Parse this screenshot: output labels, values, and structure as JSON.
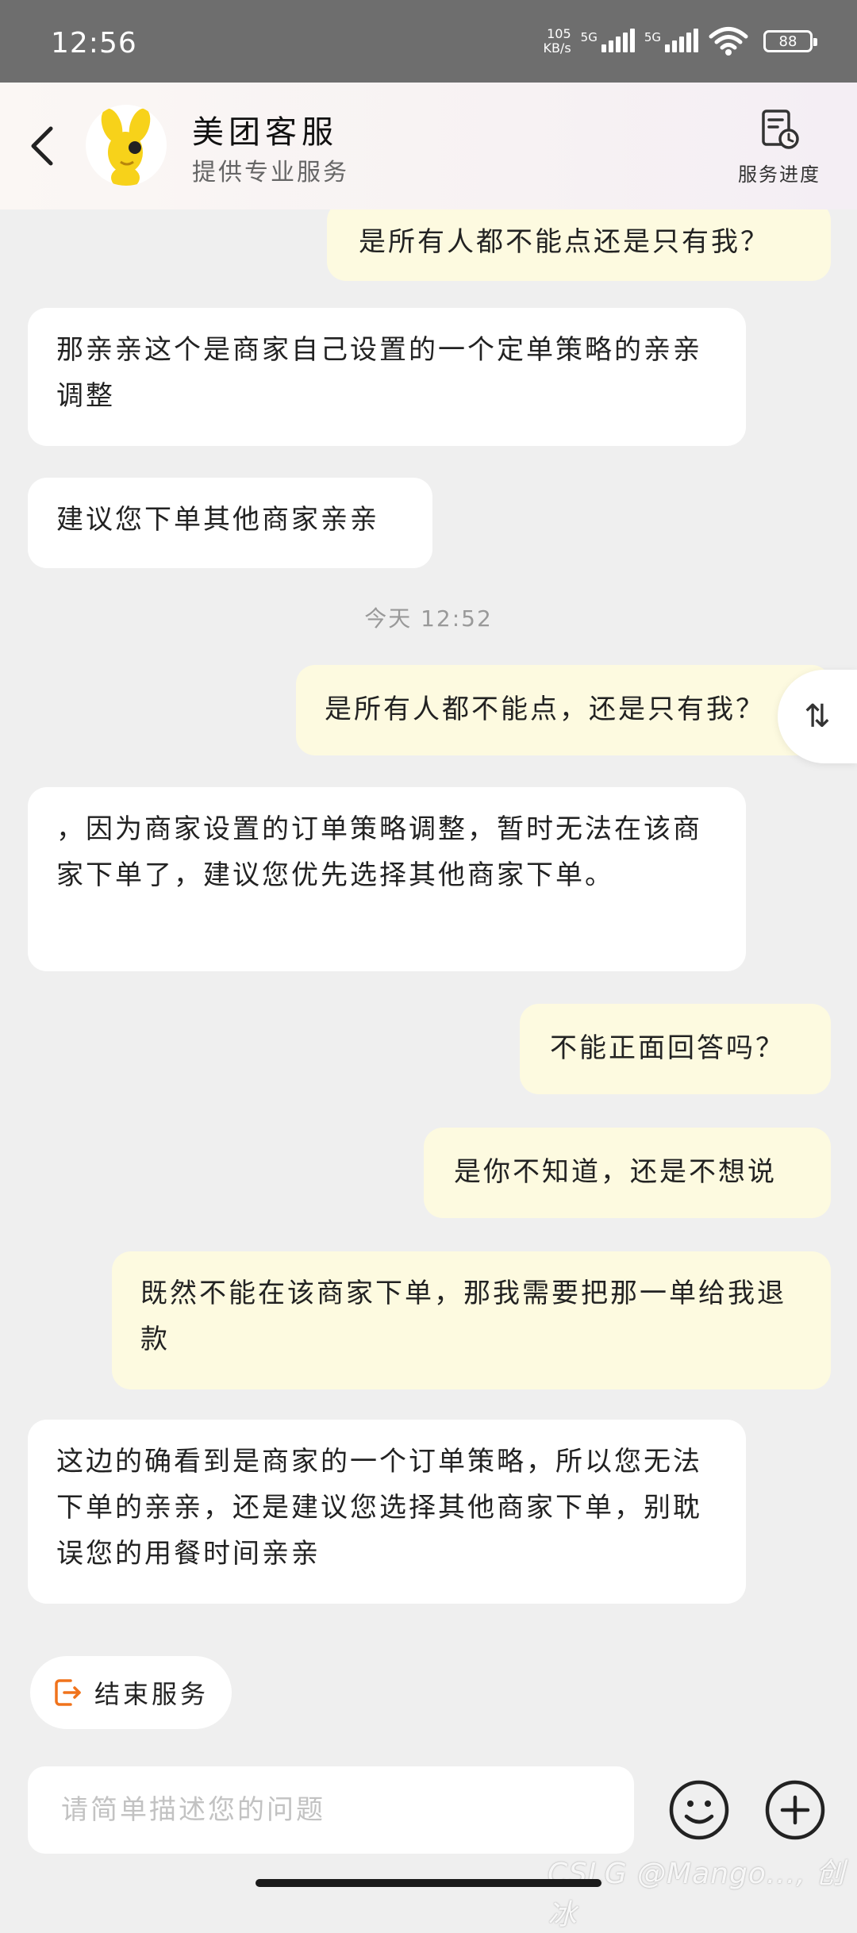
{
  "status_bar": {
    "time": "12:56",
    "net_speed_value": "105",
    "net_speed_unit": "KB/s",
    "sim1_tag": "5G",
    "sim2_tag": "5G",
    "battery": "88"
  },
  "header": {
    "title": "美团客服",
    "subtitle": "提供专业服务",
    "progress_label": "服务进度"
  },
  "messages": [
    {
      "from": "user",
      "text": "是所有人都不能点还是只有我？"
    },
    {
      "from": "agent",
      "text": "那亲亲这个是商家自己设置的一个定单策略的亲亲调整"
    },
    {
      "from": "agent",
      "text": "建议您下单其他商家亲亲"
    },
    {
      "type": "timestamp",
      "text": "今天 12:52"
    },
    {
      "from": "user",
      "text": "是所有人都不能点，还是只有我？"
    },
    {
      "from": "agent",
      "text": "，因为商家设置的订单策略调整，暂时无法在该商家下单了，建议您优先选择其他商家下单。"
    },
    {
      "from": "user",
      "text": "不能正面回答吗？"
    },
    {
      "from": "user",
      "text": "是你不知道，还是不想说"
    },
    {
      "from": "user",
      "text": "既然不能在该商家下单，那我需要把那一单给我退款"
    },
    {
      "from": "agent",
      "text": "这边的确看到是商家的一个订单策略，所以您无法下单的亲亲，还是建议您选择其他商家下单，别耽误您的用餐时间亲亲"
    }
  ],
  "scroll_button": "⇅",
  "end_service_label": "结束服务",
  "input": {
    "placeholder": "请简单描述您的问题"
  },
  "watermark": "CSLG @Mango..., 创冰",
  "colors": {
    "user_bubble": "#fdfae0",
    "agent_bubble": "#ffffff",
    "accent_orange": "#f0731c",
    "avatar_yellow": "#f7d21a"
  }
}
